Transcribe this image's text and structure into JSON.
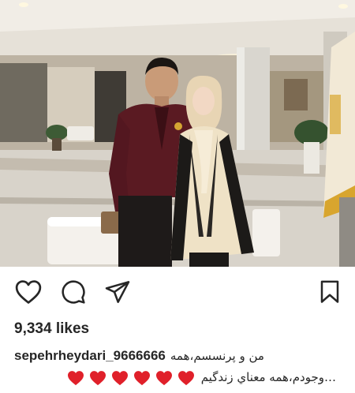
{
  "post": {
    "photo_alt": "",
    "actions": {
      "like": "heart-outline",
      "comment": "comment-bubble",
      "share": "paper-plane",
      "save": "bookmark"
    },
    "likes_text": "9,334 likes",
    "caption": {
      "username": "sepehrheydari_9666666",
      "line1_text": "من و پرنسسم،همه",
      "heart_count": 6,
      "heart_color": "#e0202a",
      "line2_text": "…وجودم،همه معناي زندگيم"
    }
  }
}
